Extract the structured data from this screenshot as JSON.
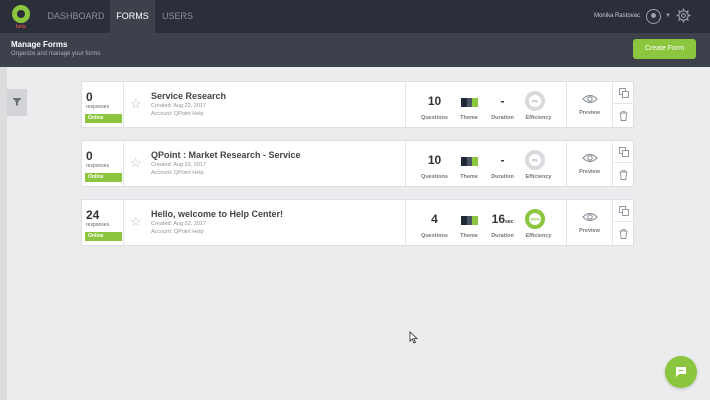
{
  "app": {
    "logo_badge": "beta",
    "nav": [
      {
        "label": "DASHBOARD",
        "active": false
      },
      {
        "label": "FORMS",
        "active": true
      },
      {
        "label": "USERS",
        "active": false
      }
    ],
    "user_name": "Monika Rastovac"
  },
  "header": {
    "title": "Manage Forms",
    "subtitle": "Organize and manage your forms",
    "create_label": "Create Form"
  },
  "labels": {
    "responses": "responses",
    "questions": "Questions",
    "theme": "Theme",
    "duration": "Duration",
    "efficiency": "Efficiency",
    "preview": "Preview"
  },
  "forms": [
    {
      "responses": "0",
      "status": "Online",
      "title": "Service Research",
      "created": "Created: Aug 22, 2017",
      "account": "Account: QPoint Help",
      "questions": "10",
      "duration": "-",
      "duration_unit": "",
      "efficiency": "0%",
      "efficiency_value": 0
    },
    {
      "responses": "0",
      "status": "Online",
      "title": "QPoint : Market Research - Service",
      "created": "Created: Aug 22, 2017",
      "account": "Account: QPoint Help",
      "questions": "10",
      "duration": "-",
      "duration_unit": "",
      "efficiency": "0%",
      "efficiency_value": 0
    },
    {
      "responses": "24",
      "status": "Online",
      "title": "Hello, welcome to Help Center!",
      "created": "Created: Aug 22, 2017",
      "account": "Account: QPoint Help",
      "questions": "4",
      "duration": "16",
      "duration_unit": "sec",
      "efficiency": "100%",
      "efficiency_value": 100
    }
  ],
  "colors": {
    "accent": "#8cc63f",
    "topbar": "#2b2f3a",
    "header": "#3c414c",
    "theme_dark": "#1f2a36",
    "theme_mid": "#4a5563",
    "theme_green": "#8cc63f",
    "gauge_empty": "#d9dadd"
  }
}
